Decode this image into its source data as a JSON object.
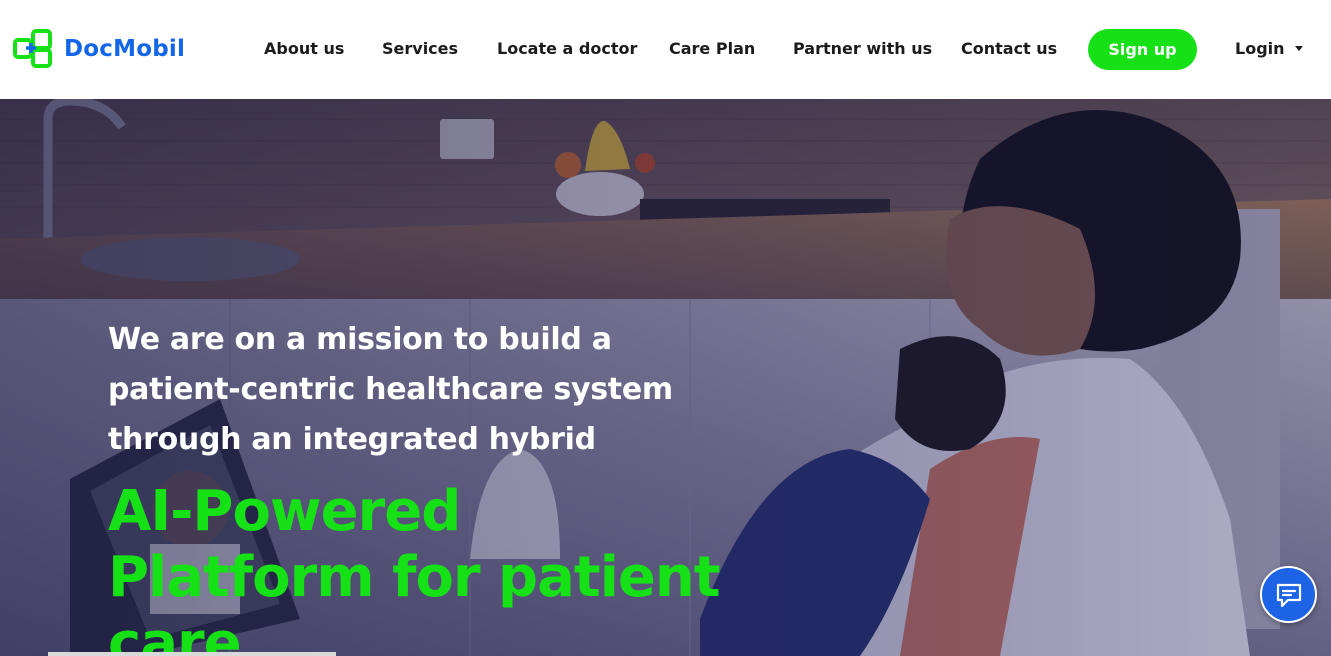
{
  "brand": {
    "name": "DocMobil",
    "logo_icon": "docmobil-logo-icon",
    "color": "#1366e8"
  },
  "nav": {
    "items": [
      {
        "label": "About us"
      },
      {
        "label": "Services"
      },
      {
        "label": "Locate a doctor"
      },
      {
        "label": "Care Plan"
      },
      {
        "label": "Partner with us"
      },
      {
        "label": "Contact us"
      }
    ],
    "signup_label": "Sign up",
    "login_label": "Login",
    "accent": "#16e016"
  },
  "hero": {
    "mission_lines": [
      "We are on a mission to build a",
      "patient-centric healthcare system",
      "through an integrated hybrid"
    ],
    "tagline_lines": [
      "AI-Powered",
      "Platform for patient",
      "care"
    ]
  },
  "chat": {
    "icon": "chat-icon"
  }
}
